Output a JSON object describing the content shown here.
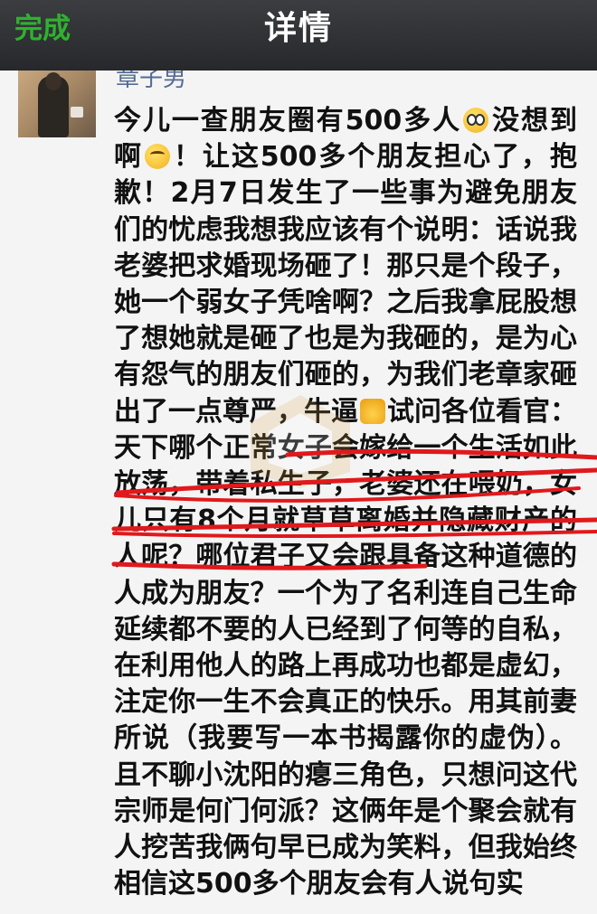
{
  "navbar": {
    "done_label": "完成",
    "title": "详情",
    "background": "#2e3033",
    "done_color": "#2fb22f"
  },
  "post": {
    "username": "章子男",
    "text_line1": "今儿一查朋友圈有500多人",
    "text_line1b": "没想到",
    "text_line2a": "啊",
    "text_line2b": "！让这500多个朋友担心了，抱歉！2月7日发生了一些事为避免朋友们的忧虑我想我应该有个说明：话说我老婆把求婚现场砸了！那只是个段子，她一个弱女子凭啥啊？之后我拿屁股想了想她就是砸了也是为我砸的，是为心有怨气的朋友们砸的，为我们老章家砸出了一点尊严，牛逼",
    "text_line7b": "试问各位看官：天下哪个正常女子会嫁给一个生活如此放荡，带着私生子，老婆还在喂奶，女儿只有8个月就草草离婚并隐藏财产的人呢？哪位君子又会跟具备这种道德的人成为朋友？一个为了名利连自己生命延续都不要的人已经到了何等的自私，在利用他人的路上再成功也都是虚幻，注定你一生不会真正的快乐。用其前妻所说（我要写一本书揭露你的虚伪）。且不聊小沈阳的瘪三角色，只想问这代宗师是何门何派？这俩年是个聚会就有人挖苦我俩句早已成为笑料，但我始终相信这500多个朋友会有人说句实",
    "emoji_1": "shocked-emoji-icon",
    "emoji_2": "thinking-emoji-icon",
    "emoji_3": "thumbs-up-emoji-icon",
    "underline_color": "#e0191c"
  }
}
